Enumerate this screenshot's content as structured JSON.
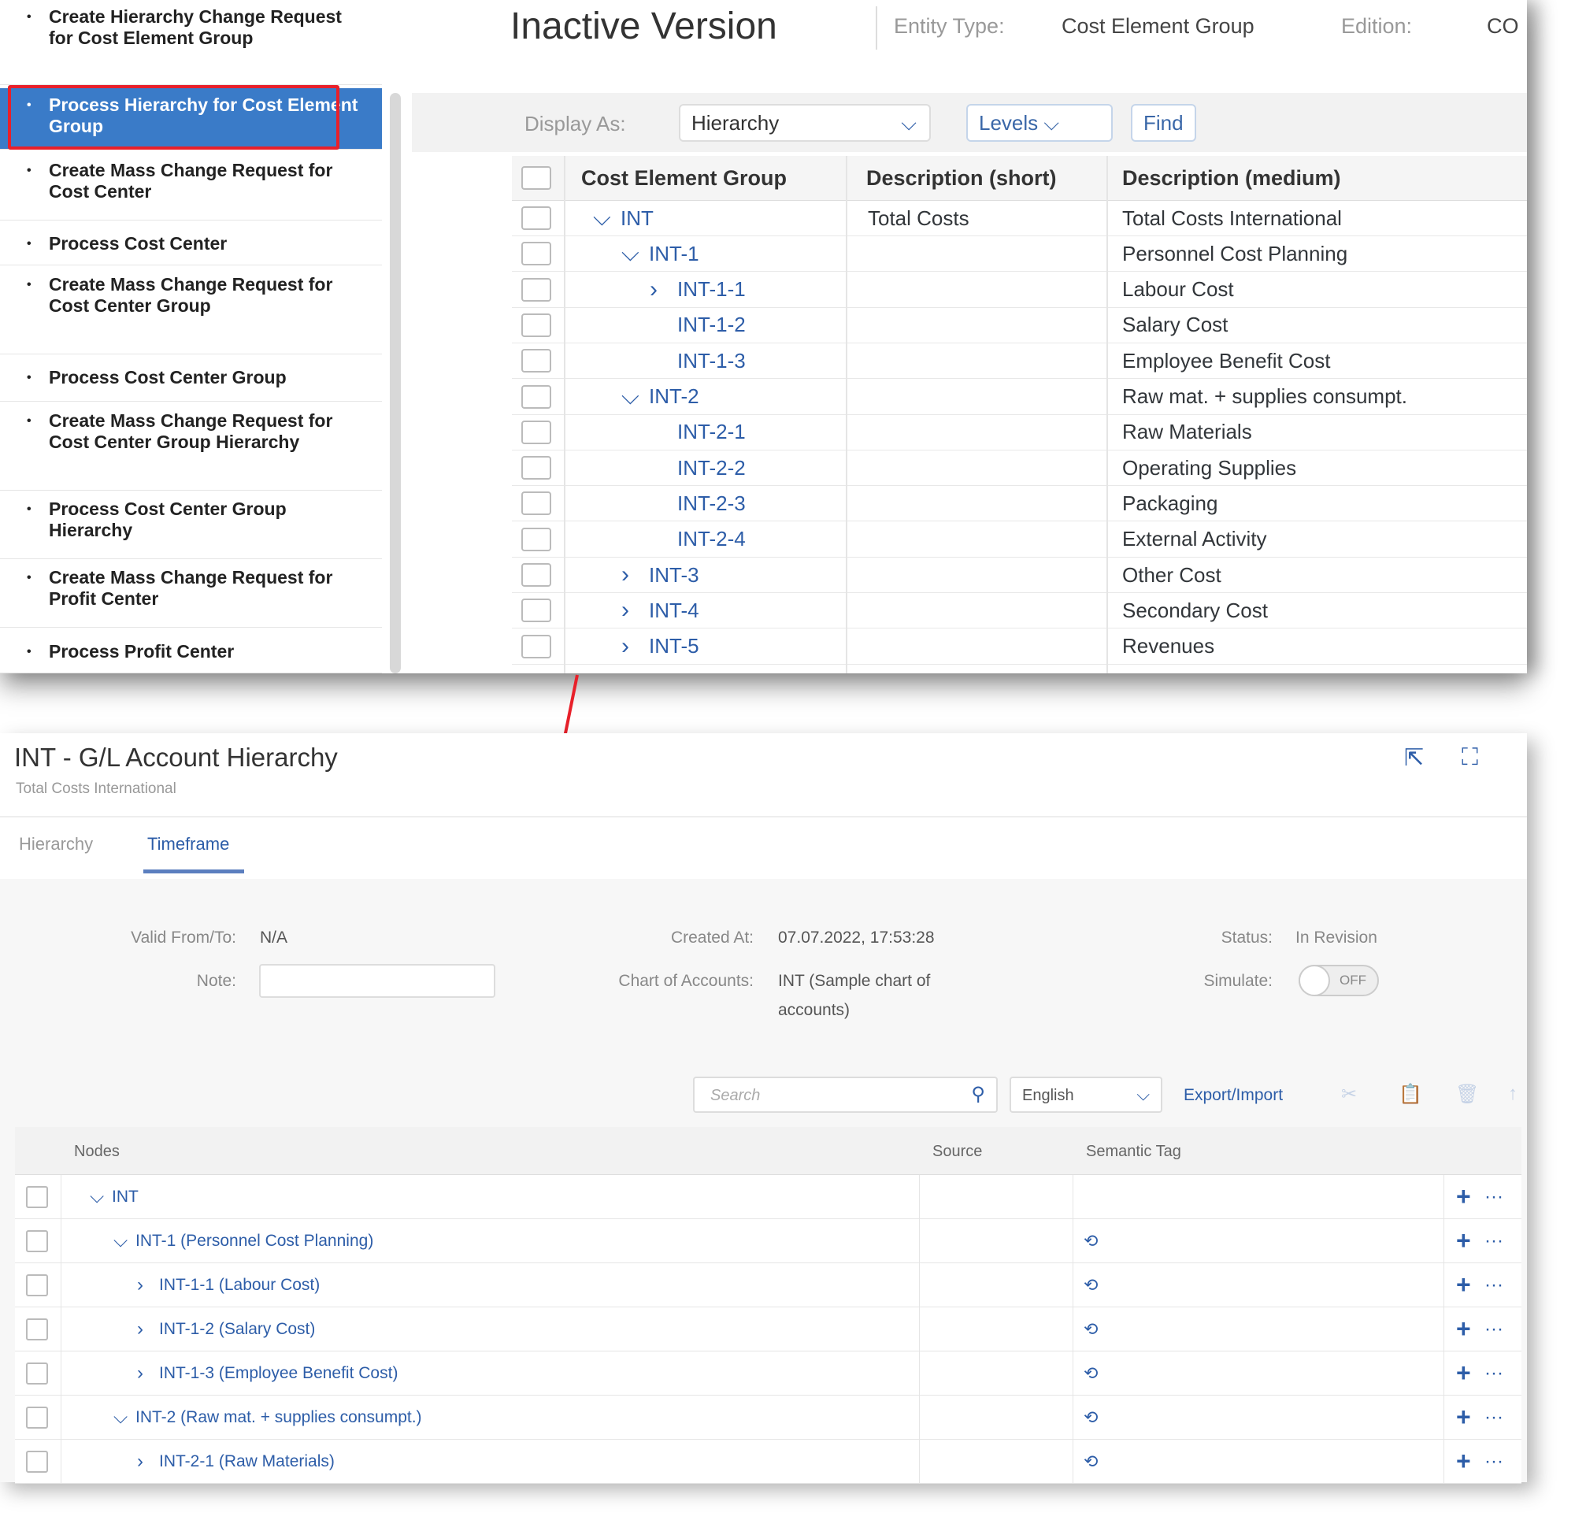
{
  "sidebar": {
    "items": [
      {
        "label": "Create Hierarchy Change Request for Cost Element Group",
        "selected": false
      },
      {
        "label": "Process Hierarchy for Cost Element Group",
        "selected": true
      },
      {
        "label": "Create Mass Change Request for Cost Center",
        "selected": false
      },
      {
        "label": "Process Cost Center",
        "selected": false
      },
      {
        "label": "Create Mass Change Request for Cost Center Group",
        "selected": false
      },
      {
        "label": "Process Cost Center Group",
        "selected": false
      },
      {
        "label": "Create Mass Change Request for Cost Center Group Hierarchy",
        "selected": false
      },
      {
        "label": "Process Cost Center Group Hierarchy",
        "selected": false
      },
      {
        "label": "Create Mass Change Request for Profit Center",
        "selected": false
      },
      {
        "label": "Process Profit Center",
        "selected": false
      }
    ]
  },
  "top": {
    "title": "Inactive Version",
    "entity_type_label": "Entity Type:",
    "entity_type_value": "Cost Element Group",
    "edition_label": "Edition:",
    "edition_value": "CO",
    "display_as_label": "Display As:",
    "display_as_value": "Hierarchy",
    "levels_label": "Levels",
    "find_label": "Find",
    "columns": [
      "Cost Element Group",
      "Description (short)",
      "Description (medium)"
    ],
    "rows": [
      {
        "group": "INT",
        "level": 0,
        "toggle": "expanded",
        "short": "Total Costs",
        "medium": "Total Costs International"
      },
      {
        "group": "INT-1",
        "level": 1,
        "toggle": "expanded",
        "short": "",
        "medium": "Personnel Cost Planning"
      },
      {
        "group": "INT-1-1",
        "level": 2,
        "toggle": "collapsed",
        "short": "",
        "medium": "Labour Cost"
      },
      {
        "group": "INT-1-2",
        "level": 2,
        "toggle": "none",
        "short": "",
        "medium": "Salary Cost"
      },
      {
        "group": "INT-1-3",
        "level": 2,
        "toggle": "none",
        "short": "",
        "medium": "Employee Benefit Cost"
      },
      {
        "group": "INT-2",
        "level": 1,
        "toggle": "expanded",
        "short": "",
        "medium": "Raw mat. + supplies consumpt."
      },
      {
        "group": "INT-2-1",
        "level": 2,
        "toggle": "none",
        "short": "",
        "medium": "Raw Materials"
      },
      {
        "group": "INT-2-2",
        "level": 2,
        "toggle": "none",
        "short": "",
        "medium": "Operating Supplies"
      },
      {
        "group": "INT-2-3",
        "level": 2,
        "toggle": "none",
        "short": "",
        "medium": "Packaging"
      },
      {
        "group": "INT-2-4",
        "level": 2,
        "toggle": "none",
        "short": "",
        "medium": "External Activity"
      },
      {
        "group": "INT-3",
        "level": 1,
        "toggle": "collapsed",
        "short": "",
        "medium": "Other Cost"
      },
      {
        "group": "INT-4",
        "level": 1,
        "toggle": "collapsed",
        "short": "",
        "medium": "Secondary Cost"
      },
      {
        "group": "INT-5",
        "level": 1,
        "toggle": "collapsed",
        "short": "",
        "medium": "Revenues"
      }
    ]
  },
  "bottom": {
    "title": "INT - G/L Account Hierarchy",
    "subtitle": "Total Costs International",
    "tabs": [
      {
        "label": "Hierarchy",
        "active": false
      },
      {
        "label": "Timeframe",
        "active": true
      }
    ],
    "valid_label": "Valid From/To:",
    "valid_value": "N/A",
    "note_label": "Note:",
    "note_value": "",
    "created_label": "Created At:",
    "created_value": "07.07.2022, 17:53:28",
    "chart_label": "Chart of Accounts:",
    "chart_value_1": "INT (Sample chart of",
    "chart_value_2": "accounts)",
    "status_label": "Status:",
    "status_value": "In Revision",
    "simulate_label": "Simulate:",
    "simulate_value": "OFF",
    "search_placeholder": "Search",
    "language_value": "English",
    "export_label": "Export/Import",
    "columns": [
      "Nodes",
      "Source",
      "Semantic Tag"
    ],
    "rows": [
      {
        "node": "INT",
        "level": 0,
        "toggle": "expanded",
        "tag": false
      },
      {
        "node": "INT-1 (Personnel Cost Planning)",
        "level": 1,
        "toggle": "expanded",
        "tag": true
      },
      {
        "node": "INT-1-1 (Labour Cost)",
        "level": 2,
        "toggle": "collapsed",
        "tag": true
      },
      {
        "node": "INT-1-2 (Salary Cost)",
        "level": 2,
        "toggle": "collapsed",
        "tag": true
      },
      {
        "node": "INT-1-3 (Employee Benefit Cost)",
        "level": 2,
        "toggle": "collapsed",
        "tag": true
      },
      {
        "node": "INT-2 (Raw mat. + supplies consumpt.)",
        "level": 1,
        "toggle": "expanded",
        "tag": true
      },
      {
        "node": "INT-2-1 (Raw Materials)",
        "level": 2,
        "toggle": "collapsed",
        "tag": true
      }
    ]
  },
  "colors": {
    "accent": "#2d5da8",
    "selected": "#3a7bc8",
    "highlight": "#e8202a"
  }
}
